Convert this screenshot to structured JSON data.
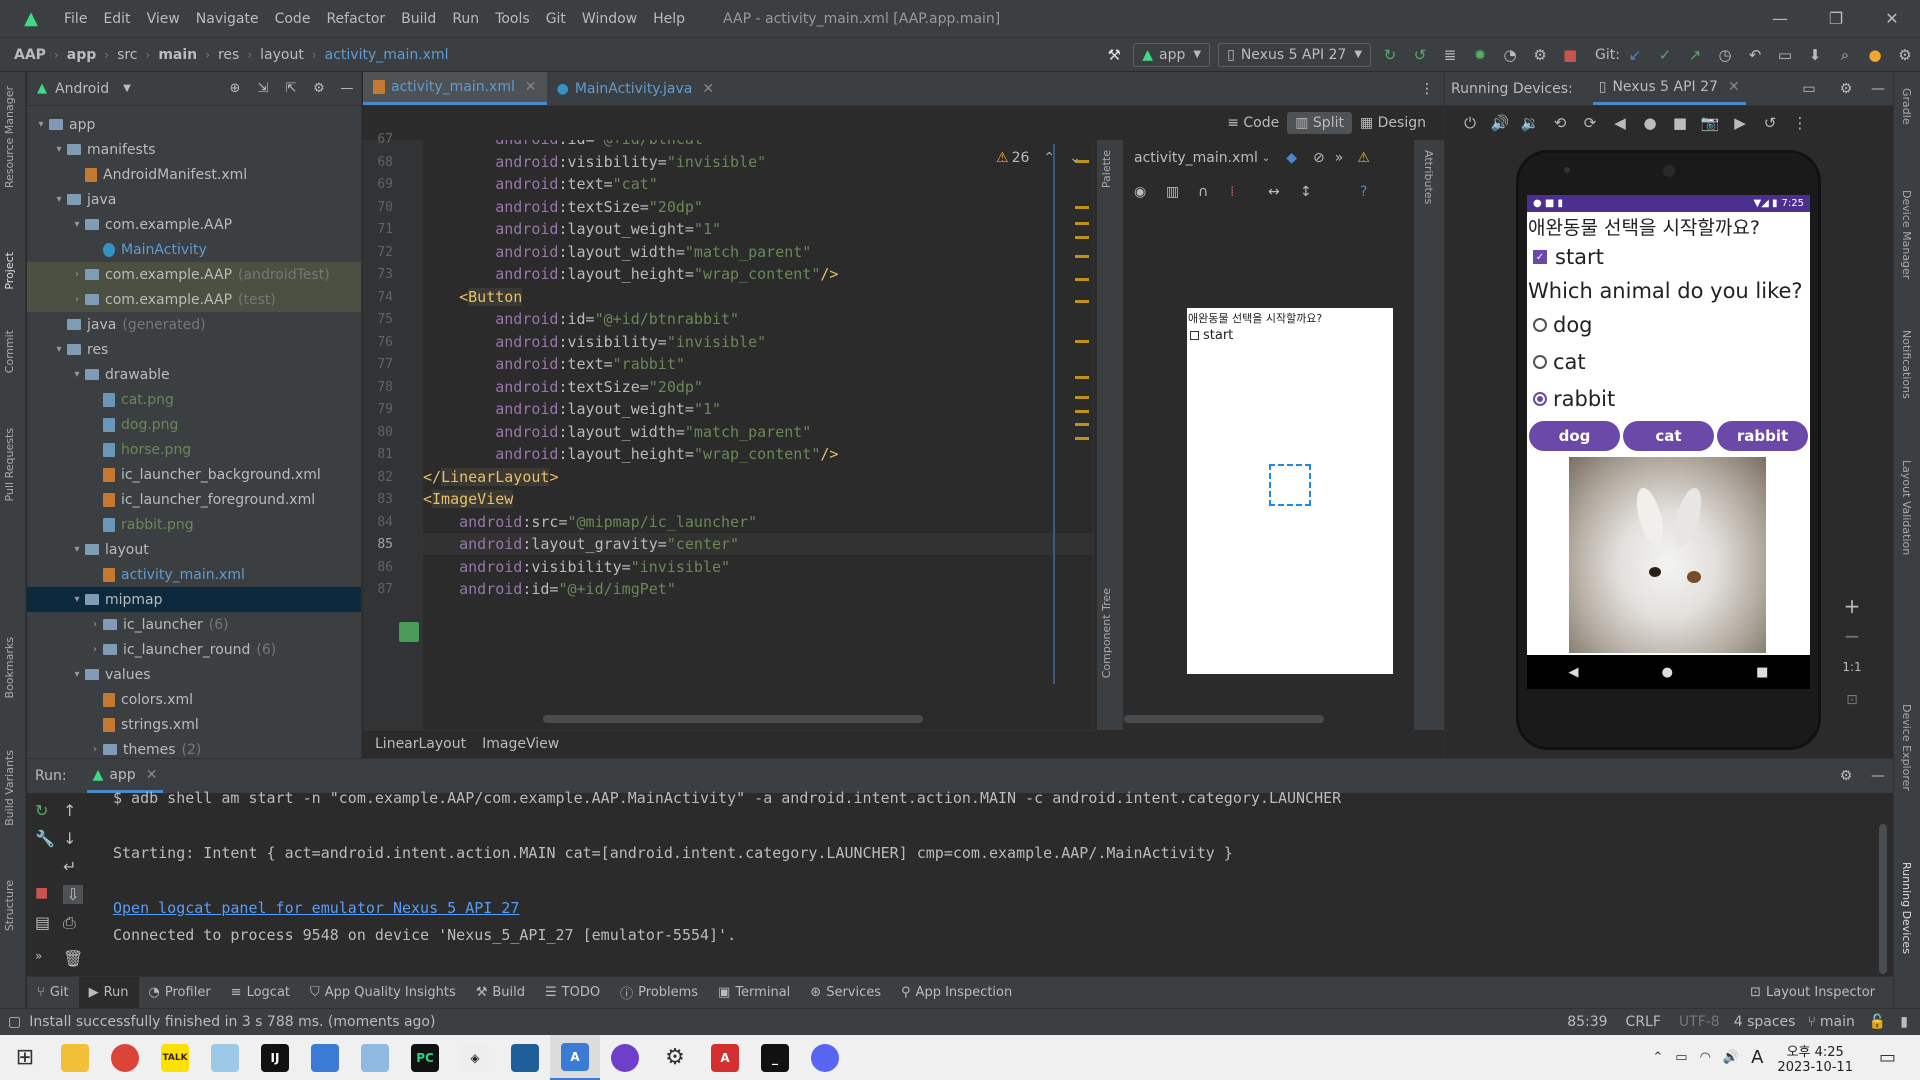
{
  "window": {
    "title": "AAP - activity_main.xml [AAP.app.main]"
  },
  "menu": [
    "File",
    "Edit",
    "View",
    "Navigate",
    "Code",
    "Refactor",
    "Build",
    "Run",
    "Tools",
    "Git",
    "Window",
    "Help"
  ],
  "breadcrumb": [
    "AAP",
    "app",
    "src",
    "main",
    "res",
    "layout",
    "activity_main.xml"
  ],
  "run_config": "app",
  "device_select": "Nexus 5 API 27",
  "git_label": "Git:",
  "project": {
    "view_label": "Android",
    "tree": [
      {
        "label": "app",
        "indent": 0,
        "type": "folder-open"
      },
      {
        "label": "manifests",
        "indent": 1,
        "type": "folder-open"
      },
      {
        "label": "AndroidManifest.xml",
        "indent": 2,
        "type": "file"
      },
      {
        "label": "java",
        "indent": 1,
        "type": "folder-open"
      },
      {
        "label": "com.example.AAP",
        "indent": 2,
        "type": "folder-open"
      },
      {
        "label": "MainActivity",
        "indent": 3,
        "type": "file"
      },
      {
        "label": "com.example.AAP",
        "suffix": "(androidTest)",
        "indent": 2,
        "type": "folder"
      },
      {
        "label": "com.example.AAP",
        "suffix": "(test)",
        "indent": 2,
        "type": "folder"
      },
      {
        "label": "java",
        "suffix": "(generated)",
        "indent": 1,
        "type": "folder"
      },
      {
        "label": "res",
        "indent": 1,
        "type": "folder-open"
      },
      {
        "label": "drawable",
        "indent": 2,
        "type": "folder-open"
      },
      {
        "label": "cat.png",
        "indent": 3,
        "type": "file"
      },
      {
        "label": "dog.png",
        "indent": 3,
        "type": "file"
      },
      {
        "label": "horse.png",
        "indent": 3,
        "type": "file"
      },
      {
        "label": "ic_launcher_background.xml",
        "indent": 3,
        "type": "file"
      },
      {
        "label": "ic_launcher_foreground.xml",
        "indent": 3,
        "type": "file"
      },
      {
        "label": "rabbit.png",
        "indent": 3,
        "type": "file"
      },
      {
        "label": "layout",
        "indent": 2,
        "type": "folder-open"
      },
      {
        "label": "activity_main.xml",
        "indent": 3,
        "type": "file"
      },
      {
        "label": "mipmap",
        "indent": 2,
        "type": "folder-open"
      },
      {
        "label": "ic_launcher",
        "suffix": "(6)",
        "indent": 3,
        "type": "folder"
      },
      {
        "label": "ic_launcher_round",
        "suffix": "(6)",
        "indent": 3,
        "type": "folder"
      },
      {
        "label": "values",
        "indent": 2,
        "type": "folder-open"
      },
      {
        "label": "colors.xml",
        "indent": 3,
        "type": "file"
      },
      {
        "label": "strings.xml",
        "indent": 3,
        "type": "file"
      },
      {
        "label": "themes",
        "suffix": "(2)",
        "indent": 3,
        "type": "folder"
      }
    ]
  },
  "editor": {
    "tabs": [
      "activity_main.xml",
      "MainActivity.java"
    ],
    "view_modes": [
      "Code",
      "Split",
      "Design"
    ],
    "warnings": "26",
    "lines": [
      {
        "n": "67",
        "text": "        android:id=\"@+id/btncat\""
      },
      {
        "n": "68",
        "text": "        android:visibility=\"invisible\""
      },
      {
        "n": "69",
        "text": "        android:text=\"cat\""
      },
      {
        "n": "70",
        "text": "        android:textSize=\"20dp\""
      },
      {
        "n": "71",
        "text": "        android:layout_weight=\"1\""
      },
      {
        "n": "72",
        "text": "        android:layout_width=\"match_parent\""
      },
      {
        "n": "73",
        "text": "        android:layout_height=\"wrap_content\"/>"
      },
      {
        "n": "74",
        "text": "    <Button"
      },
      {
        "n": "75",
        "text": "        android:id=\"@+id/btnrabbit\""
      },
      {
        "n": "76",
        "text": "        android:visibility=\"invisible\""
      },
      {
        "n": "77",
        "text": "        android:text=\"rabbit\""
      },
      {
        "n": "78",
        "text": "        android:textSize=\"20dp\""
      },
      {
        "n": "79",
        "text": "        android:layout_weight=\"1\""
      },
      {
        "n": "80",
        "text": "        android:layout_width=\"match_parent\""
      },
      {
        "n": "81",
        "text": "        android:layout_height=\"wrap_content\"/>"
      },
      {
        "n": "82",
        "text": "</LinearLayout>"
      },
      {
        "n": "83",
        "text": "<ImageView"
      },
      {
        "n": "84",
        "text": "    android:src=\"@mipmap/ic_launcher\""
      },
      {
        "n": "85",
        "text": "    android:layout_gravity=\"center\""
      },
      {
        "n": "86",
        "text": "    android:visibility=\"invisible\""
      },
      {
        "n": "87",
        "text": "    android:id=\"@+id/imgPet\""
      }
    ],
    "breadcrumb": [
      "LinearLayout",
      "ImageView"
    ]
  },
  "design": {
    "file_select": "activity_main.xml",
    "palette_label": "Palette",
    "component_tree_label": "Component Tree",
    "attributes_label": "Attributes",
    "preview_title": "애완동물 선택을 시작할까요?",
    "preview_check": "start"
  },
  "devices": {
    "header": "Running Devices:",
    "tab": "Nexus 5 API 27",
    "status_time": "7:25",
    "app": {
      "title": "애완동물 선택을 시작할까요?",
      "check": "start",
      "question": "Which animal do you like?",
      "options": [
        "dog",
        "cat",
        "rabbit"
      ],
      "buttons": [
        "dog",
        "cat",
        "rabbit"
      ],
      "zoom_ratio": "1:1"
    }
  },
  "run": {
    "label": "Run:",
    "tab": "app",
    "lines": [
      "$ adb shell am start -n \"com.example.AAP/com.example.AAP.MainActivity\" -a android.intent.action.MAIN -c android.intent.category.LAUNCHER",
      "",
      "Starting: Intent { act=android.intent.action.MAIN cat=[android.intent.category.LAUNCHER] cmp=com.example.AAP/.MainActivity }",
      "",
      "Open logcat panel for emulator Nexus 5 API 27",
      "Connected to process 9548 on device 'Nexus_5_API_27 [emulator-5554]'."
    ]
  },
  "bottom_tabs": [
    "Git",
    "Run",
    "Profiler",
    "Logcat",
    "App Quality Insights",
    "Build",
    "TODO",
    "Problems",
    "Terminal",
    "Services",
    "App Inspection"
  ],
  "layout_inspector": "Layout Inspector",
  "status": {
    "message": "Install successfully finished in 3 s 788 ms. (moments ago)",
    "position": "85:39",
    "line_sep": "CRLF",
    "encoding": "UTF-8",
    "indent": "4 spaces",
    "branch": "main"
  },
  "left_stripe": [
    "Resource Manager",
    "Project",
    "Commit",
    "Pull Requests",
    "Bookmarks",
    "Build Variants",
    "Structure"
  ],
  "right_stripe": [
    "Gradle",
    "Device Manager",
    "Notifications",
    "Layout Validation",
    "Device Explorer",
    "Running Devices"
  ],
  "taskbar": {
    "ime": "A",
    "time": "오후 4:25",
    "date": "2023-10-11"
  }
}
